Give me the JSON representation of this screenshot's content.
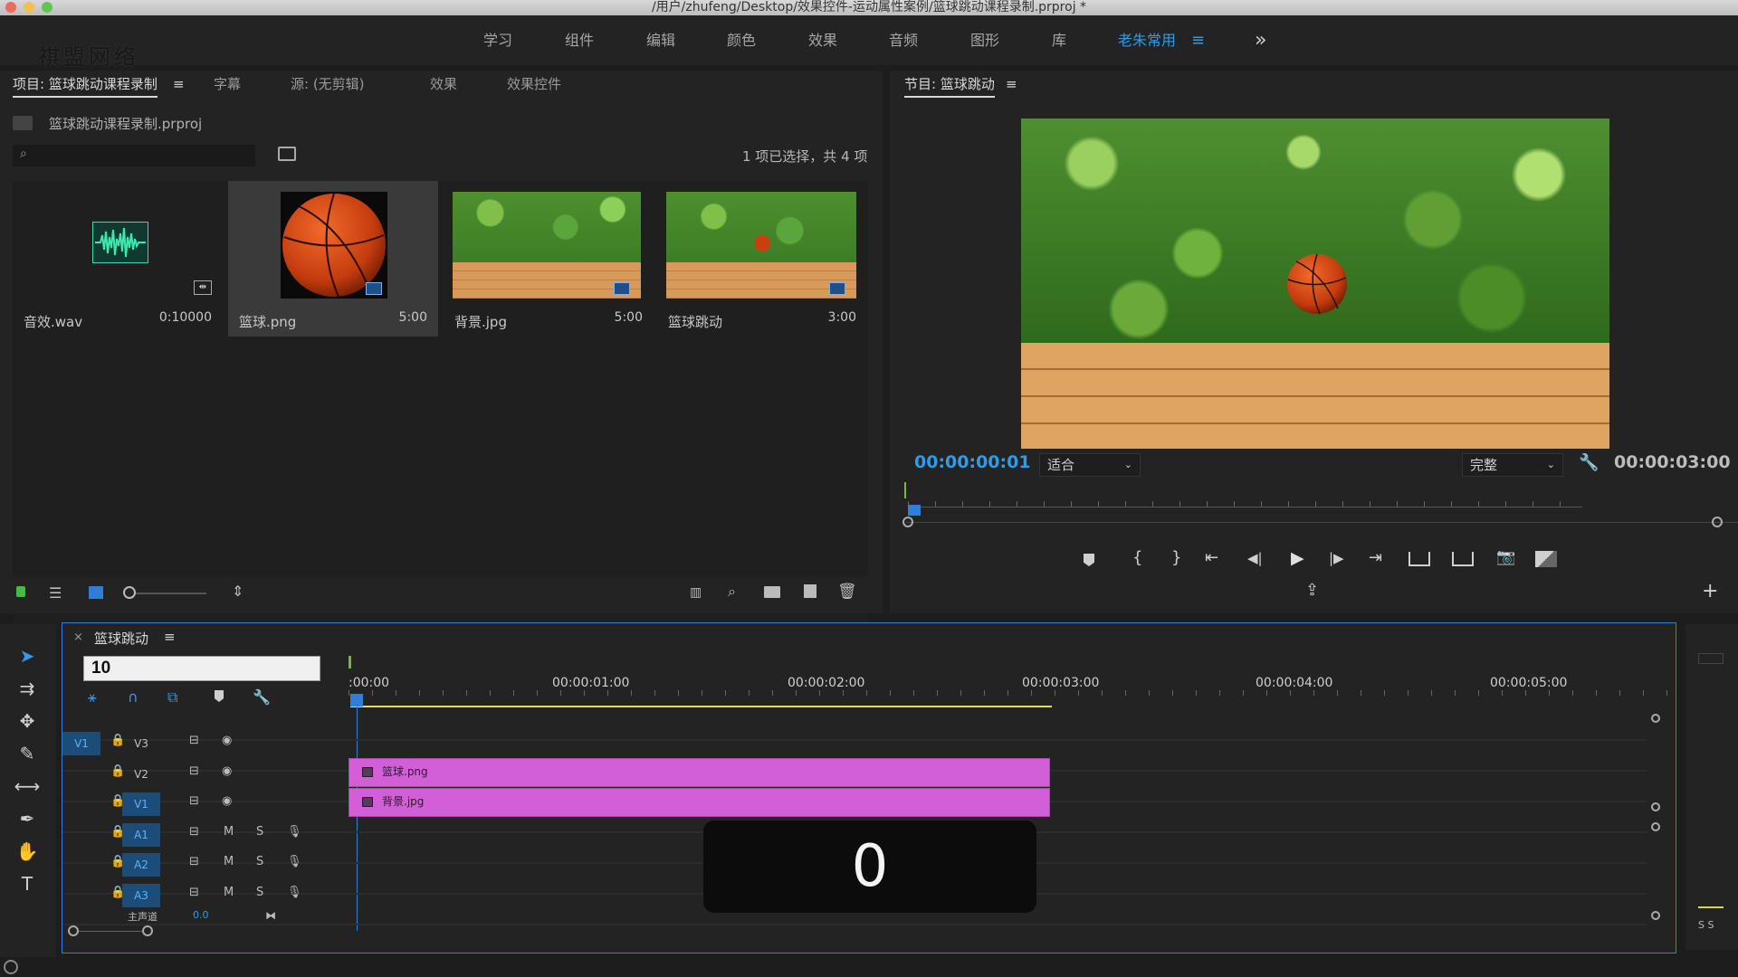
{
  "window": {
    "title": "/用户/zhufeng/Desktop/效果控件-运动属性案例/篮球跳动课程录制.prproj *"
  },
  "watermark": "祺盟网络",
  "workspaces": {
    "tabs": [
      "学习",
      "组件",
      "编辑",
      "颜色",
      "效果",
      "音频",
      "图形",
      "库",
      "老朱常用"
    ],
    "active": "老朱常用",
    "overflow_glyph": "»"
  },
  "project_panel": {
    "tabs": [
      "项目: 篮球跳动课程录制",
      "字幕",
      "源: (无剪辑)",
      "效果",
      "效果控件"
    ],
    "file": "篮球跳动课程录制.prproj",
    "search_placeholder": "",
    "selection_info": "1 项已选择，共 4 项",
    "items": [
      {
        "name": "音效.wav",
        "duration": "0:10000"
      },
      {
        "name": "篮球.png",
        "duration": "5:00"
      },
      {
        "name": "背景.jpg",
        "duration": "5:00"
      },
      {
        "name": "篮球跳动",
        "duration": "3:00"
      }
    ]
  },
  "program_monitor": {
    "title": "节目: 篮球跳动",
    "timecode": "00:00:00:01",
    "zoom": "适合",
    "quality": "完整",
    "duration": "00:00:03:00"
  },
  "timeline": {
    "sequence": "篮球跳动",
    "timecode_input": "10",
    "ruler": [
      ":00:00",
      "00:00:01:00",
      "00:00:02:00",
      "00:00:03:00",
      "00:00:04:00",
      "00:00:05:00"
    ],
    "video_tracks": [
      "V3",
      "V2",
      "V1"
    ],
    "audio_tracks": [
      "A1",
      "A2",
      "A3"
    ],
    "source_patch": "V1",
    "track_buttons": {
      "mute": "M",
      "solo": "S"
    },
    "master_partial": "主声道",
    "master_value": "0.0",
    "clips": [
      {
        "name": "篮球.png",
        "track": "V2"
      },
      {
        "name": "背景.jpg",
        "track": "V1"
      }
    ]
  },
  "overlay_counter": "0",
  "audio_meter": {
    "labels": "S S"
  },
  "colors": {
    "accent": "#2f9be9",
    "clip": "#d35fd6",
    "panel": "#232323"
  }
}
